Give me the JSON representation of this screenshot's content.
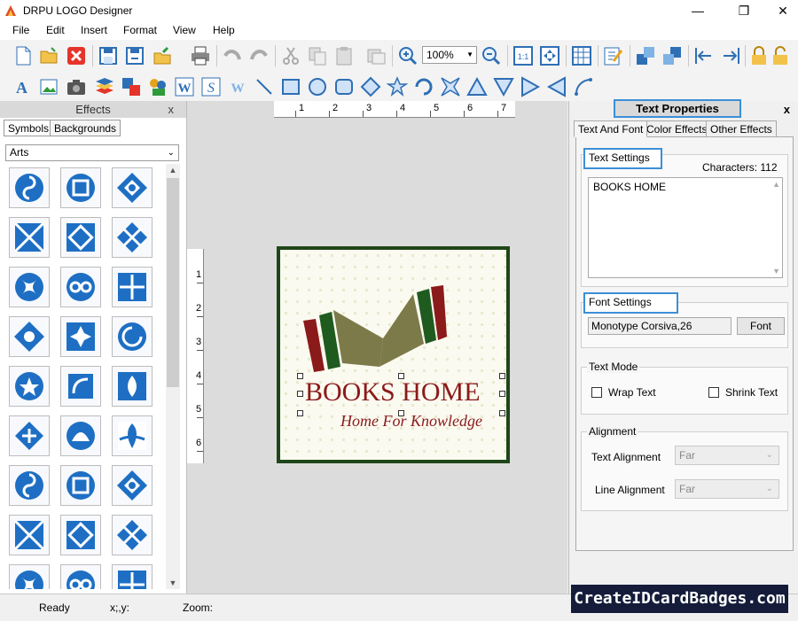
{
  "window": {
    "title": "DRPU LOGO Designer",
    "minimize": "—",
    "maximize": "❐",
    "close": "✕"
  },
  "menu": [
    "File",
    "Edit",
    "Insert",
    "Format",
    "View",
    "Help"
  ],
  "toolbar": {
    "zoom": "100%"
  },
  "effects": {
    "title": "Effects",
    "close": "x",
    "tabs": [
      "Symbols",
      "Backgrounds"
    ],
    "category": "Arts",
    "symbol_color": "#1e6fc4"
  },
  "ruler": {
    "h": [
      "1",
      "2",
      "3",
      "4",
      "5",
      "6",
      "7"
    ],
    "v": [
      "1",
      "2",
      "3",
      "4",
      "5",
      "6"
    ]
  },
  "logo": {
    "title": "BOOKS HOME",
    "subtitle": "Home For Knowledge",
    "text_color": "#8b1a1a",
    "border_color": "#1f4618"
  },
  "props": {
    "title": "Text Properties",
    "close": "x",
    "tabs": [
      "Text And Font",
      "Color Effects",
      "Other Effects"
    ],
    "text_settings_label": "Text Settings",
    "characters": "Characters: 112",
    "text_value": "BOOKS HOME",
    "font_settings_label": "Font Settings",
    "font_value": "Monotype Corsiva,26",
    "font_button": "Font",
    "text_mode_label": "Text Mode",
    "wrap_text": "Wrap Text",
    "shrink_text": "Shrink Text",
    "alignment_label": "Alignment",
    "text_alignment_label": "Text Alignment",
    "text_alignment_value": "Far",
    "line_alignment_label": "Line Alignment",
    "line_alignment_value": "Far"
  },
  "status": {
    "ready": "Ready",
    "coords": "x;,y:",
    "zoom": "Zoom:"
  },
  "watermark": "CreateIDCardBadges.com"
}
